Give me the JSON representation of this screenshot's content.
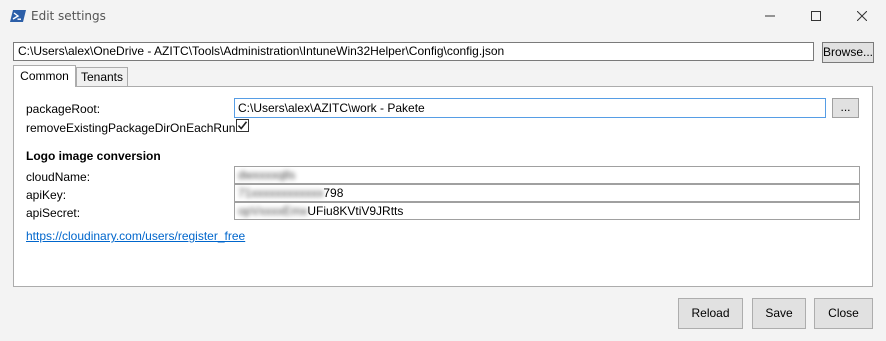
{
  "window": {
    "title": "Edit settings",
    "icon": "powershell-icon",
    "controls": [
      "minimize-icon",
      "maximize-icon",
      "close-icon"
    ]
  },
  "config": {
    "path": "C:\\Users\\alex\\OneDrive - AZITC\\Tools\\Administration\\IntuneWin32Helper\\Config\\config.json",
    "browse_label": "Browse..."
  },
  "tabs": [
    {
      "label": "Common",
      "active": true
    },
    {
      "label": "Tenants",
      "active": false
    }
  ],
  "common": {
    "packageRoot": {
      "label": "packageRoot:",
      "value": "C:\\Users\\alex\\AZITC\\work - Pakete",
      "browse_label": "..."
    },
    "removeExisting": {
      "label": "removeExistingPackageDirOnEachRun:",
      "checked": true
    },
    "logo_section_title": "Logo image conversion",
    "cloudName": {
      "label": "cloudName:",
      "value": "dwxxxxqlls"
    },
    "apiKey": {
      "label": "apiKey:",
      "value_blurred": "71xxxxxxxxxxxx",
      "value_visible": "798"
    },
    "apiSecret": {
      "label": "apiSecret:",
      "value_blurred": "opVxxxxEmx",
      "value_visible": "UFiu8KVtiV9JRtts"
    },
    "register_link": "https://cloudinary.com/users/register_free"
  },
  "buttons": {
    "reload": "Reload",
    "save": "Save",
    "close": "Close"
  },
  "colors": {
    "link": "#0066cc",
    "focus_border": "#569de5",
    "powershell_blue": "#2c5fa8"
  }
}
